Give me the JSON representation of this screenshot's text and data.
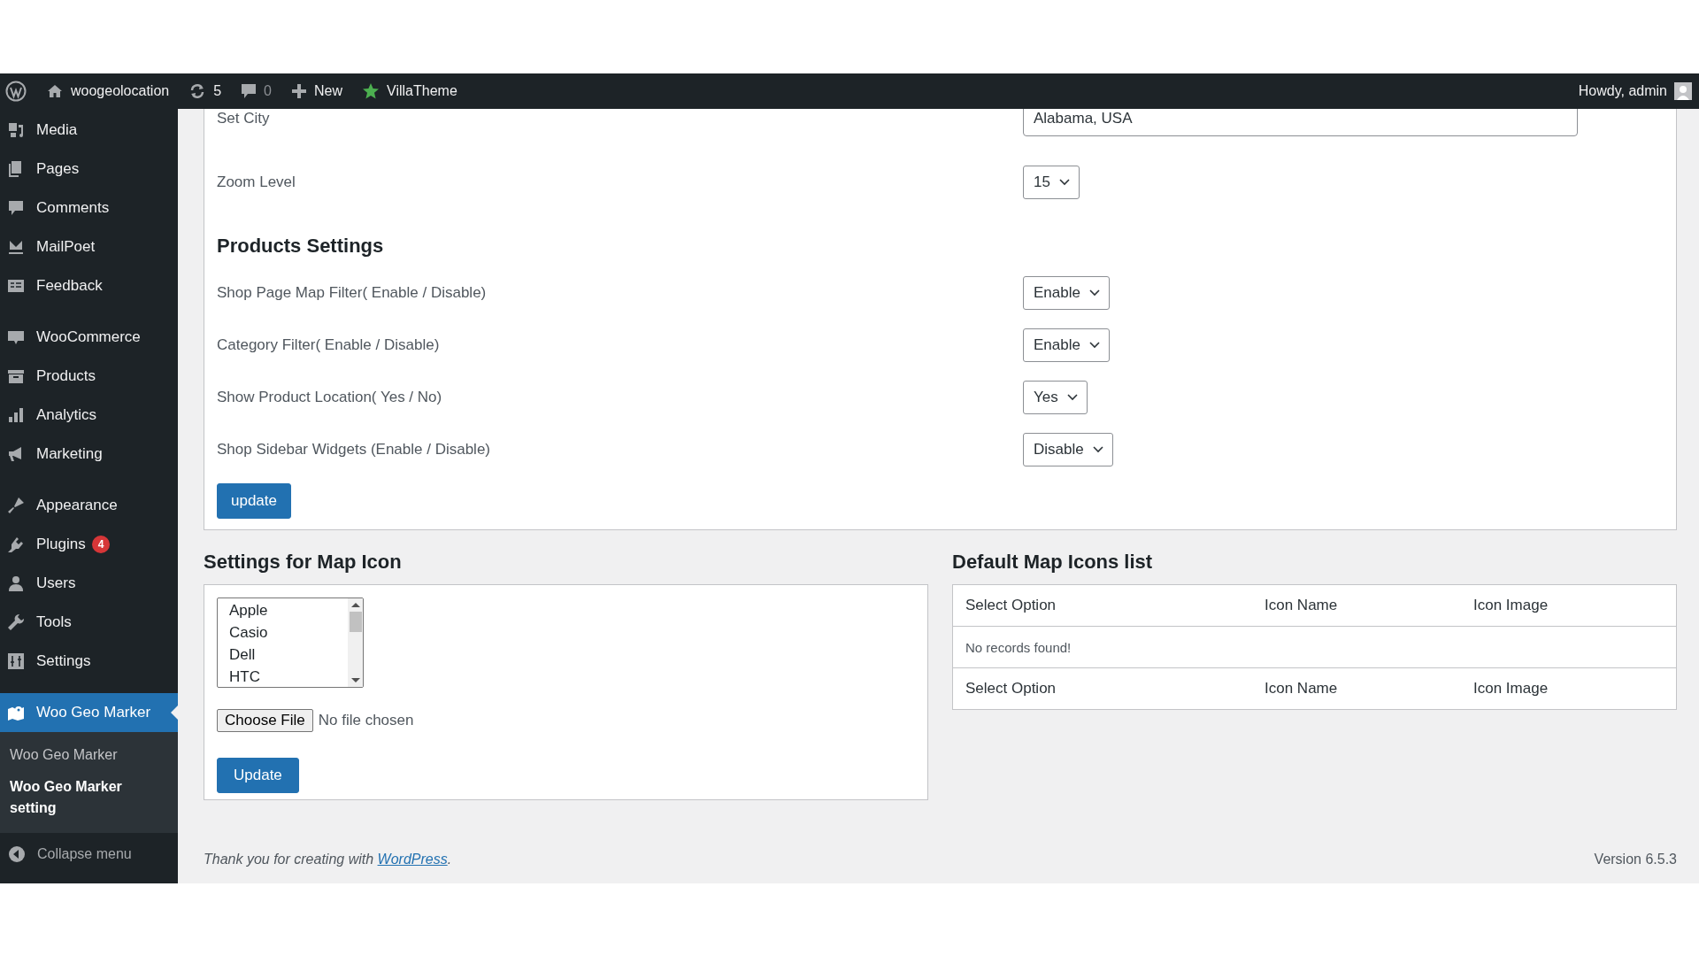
{
  "admin_bar": {
    "items": [
      {
        "kind": "site",
        "label": "woogeolocation"
      },
      {
        "kind": "updates",
        "label": "5"
      },
      {
        "kind": "comments",
        "label": "0"
      },
      {
        "kind": "new",
        "label": "New"
      },
      {
        "kind": "theme",
        "label": "VillaTheme"
      }
    ],
    "account": "Howdy, admin"
  },
  "sidebar": {
    "groups": [
      [
        {
          "label": "Media",
          "selected": false
        },
        {
          "label": "Pages",
          "selected": false
        },
        {
          "label": "Comments",
          "selected": false
        },
        {
          "label": "MailPoet",
          "selected": false
        },
        {
          "label": "Feedback",
          "selected": false
        }
      ],
      [
        {
          "label": "WooCommerce",
          "selected": false
        },
        {
          "label": "Products",
          "selected": false
        },
        {
          "label": "Analytics",
          "selected": false
        },
        {
          "label": "Marketing",
          "selected": false
        }
      ],
      [
        {
          "label": "Appearance",
          "selected": false
        },
        {
          "label": "Plugins",
          "selected": false,
          "badge": "4"
        },
        {
          "label": "Users",
          "selected": false
        },
        {
          "label": "Tools",
          "selected": false
        },
        {
          "label": "Settings",
          "selected": false
        }
      ],
      [
        {
          "label": "Woo Geo Marker",
          "selected": true
        }
      ]
    ],
    "submenu": [
      {
        "label": "Woo Geo Marker",
        "selected": false
      },
      {
        "label": "Woo Geo Marker setting",
        "selected": true
      }
    ],
    "collapse": "Collapse menu"
  },
  "settings": {
    "rows": [
      {
        "kind": "text",
        "label": "Set City",
        "value": "Alabama, USA"
      },
      {
        "kind": "select",
        "label": "Zoom Level",
        "value": "15"
      },
      {
        "kind": "heading",
        "label": "Products Settings"
      },
      {
        "kind": "select",
        "label": "Shop Page Map Filter( Enable / Disable)",
        "value": "Enable"
      },
      {
        "kind": "select",
        "label": "Category Filter( Enable / Disable)",
        "value": "Enable"
      },
      {
        "kind": "select",
        "label": "Show Product Location( Yes / No)",
        "value": "Yes"
      },
      {
        "kind": "select",
        "label": "Shop Sidebar Widgets (Enable / Disable)",
        "value": "Disable"
      }
    ],
    "button": "update"
  },
  "map_icon": {
    "title": "Settings for Map Icon",
    "options": [
      {
        "label": "Apple",
        "selected": false
      },
      {
        "label": "Casio",
        "selected": false
      },
      {
        "label": "Dell",
        "selected": false
      },
      {
        "label": "HTC",
        "selected": false
      }
    ],
    "file_button": "Choose File",
    "file_status": "No file chosen",
    "button": "Update"
  },
  "icons_list": {
    "title": "Default Map Icons list",
    "columns": [
      "Select Option",
      "Icon Name",
      "Icon Image"
    ],
    "empty_message": "No records found!",
    "footer_columns": [
      "Select Option",
      "Icon Name",
      "Icon Image"
    ]
  },
  "footer": {
    "text": "Thank you for creating with ",
    "link": "WordPress",
    "after": ".",
    "version": "Version 6.5.3"
  }
}
